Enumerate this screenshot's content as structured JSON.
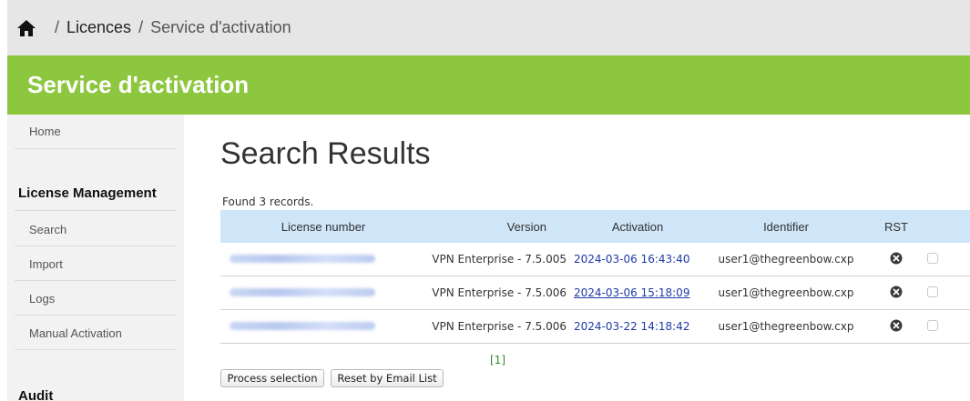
{
  "breadcrumb": {
    "separator": "/",
    "items": [
      "Licences",
      "Service d'activation"
    ]
  },
  "banner": {
    "title": "Service d'activation"
  },
  "sidebar": {
    "home": "Home",
    "license_heading": "License Management",
    "items": [
      "Search",
      "Import",
      "Logs",
      "Manual Activation"
    ],
    "audit_heading": "Audit"
  },
  "main": {
    "title": "Search Results",
    "found_text": "Found 3 records.",
    "columns": [
      "License number",
      "Version",
      "Activation",
      "Identifier",
      "RST"
    ],
    "rows": [
      {
        "version": "VPN Enterprise - 7.5.005",
        "activation": "2024-03-06 16:43:40",
        "identifier": "user1@thegreenbow.cxp"
      },
      {
        "version": "VPN Enterprise - 7.5.006",
        "activation": "2024-03-06 15:18:09",
        "identifier": "user1@thegreenbow.cxp"
      },
      {
        "version": "VPN Enterprise - 7.5.006",
        "activation": "2024-03-22 14:18:42",
        "identifier": "user1@thegreenbow.cxp"
      }
    ],
    "pager": "[1]",
    "buttons": {
      "process": "Process selection",
      "reset": "Reset by Email List"
    }
  },
  "icons": {
    "home": "home-icon",
    "reset": "x-circle-icon"
  },
  "colors": {
    "banner": "#8dc63f",
    "header_row": "#cfe5f8",
    "link": "#1f3aa8",
    "pager": "#2e8b2e"
  }
}
